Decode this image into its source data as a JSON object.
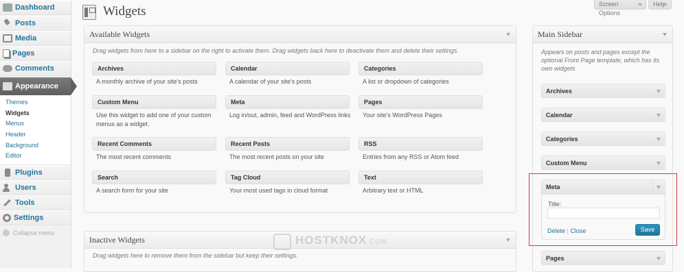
{
  "menu": {
    "items_top": [
      {
        "label": "Dashboard",
        "icon": "dashboard-icon"
      },
      {
        "label": "Posts",
        "icon": "pin-icon"
      },
      {
        "label": "Media",
        "icon": "media-icon"
      },
      {
        "label": "Pages",
        "icon": "pages-icon"
      },
      {
        "label": "Comments",
        "icon": "comments-icon"
      }
    ],
    "appearance": {
      "label": "Appearance",
      "icon": "appearance-icon"
    },
    "submenu": [
      "Themes",
      "Widgets",
      "Menus",
      "Header",
      "Background",
      "Editor"
    ],
    "items_bottom": [
      {
        "label": "Plugins",
        "icon": "plugin-icon"
      },
      {
        "label": "Users",
        "icon": "users-icon"
      },
      {
        "label": "Tools",
        "icon": "tools-icon"
      },
      {
        "label": "Settings",
        "icon": "settings-icon"
      }
    ],
    "collapse": "Collapse menu"
  },
  "header": {
    "title": "Widgets",
    "screen_options": "Screen Options",
    "help": "Help"
  },
  "available": {
    "title": "Available Widgets",
    "description": "Drag widgets from here to a sidebar on the right to activate them. Drag widgets back here to deactivate them and delete their settings.",
    "widgets": [
      {
        "name": "Archives",
        "desc": "A monthly archive of your site's posts"
      },
      {
        "name": "Calendar",
        "desc": "A calendar of your site's posts"
      },
      {
        "name": "Categories",
        "desc": "A list or dropdown of categories"
      },
      {
        "name": "Custom Menu",
        "desc": "Use this widget to add one of your custom menus as a widget."
      },
      {
        "name": "Meta",
        "desc": "Log in/out, admin, feed and WordPress links"
      },
      {
        "name": "Pages",
        "desc": "Your site's WordPress Pages"
      },
      {
        "name": "Recent Comments",
        "desc": "The most recent comments"
      },
      {
        "name": "Recent Posts",
        "desc": "The most recent posts on your site"
      },
      {
        "name": "RSS",
        "desc": "Entries from any RSS or Atom feed"
      },
      {
        "name": "Search",
        "desc": "A search form for your site"
      },
      {
        "name": "Tag Cloud",
        "desc": "Your most used tags in cloud format"
      },
      {
        "name": "Text",
        "desc": "Arbitrary text or HTML"
      }
    ]
  },
  "inactive": {
    "title": "Inactive Widgets",
    "description": "Drag widgets here to remove them from the sidebar but keep their settings."
  },
  "main_sidebar": {
    "title": "Main Sidebar",
    "description": "Appears on posts and pages except the optional Front Page template, which has its own widgets",
    "widgets": [
      "Archives",
      "Calendar",
      "Categories",
      "Custom Menu"
    ],
    "meta": {
      "name": "Meta",
      "title_label": "Title:",
      "title_value": "",
      "delete": "Delete",
      "separator": "|",
      "close": "Close",
      "save": "Save"
    },
    "after": "Pages"
  },
  "watermark": {
    "text": "HOSTKNOX",
    "suffix": ".COM"
  },
  "colors": {
    "link": "#21759b",
    "current_menu": "#5f5f5f",
    "save_button": "#21759b",
    "highlight": "#d23a3a"
  }
}
